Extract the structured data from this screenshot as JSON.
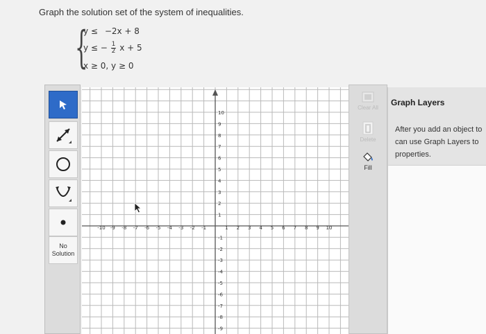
{
  "question": "Graph the solution set of the system of inequalities.",
  "system": {
    "line1": {
      "lhs": "y ≤",
      "rhs": "−2x + 8"
    },
    "line2": {
      "lhs": "y ≤ −",
      "num": "1",
      "den": "2",
      "rhs": "x + 5"
    },
    "line3": "x ≥ 0, y ≥ 0"
  },
  "toolbar": {
    "tools": [
      "pointer-tool",
      "segment-tool",
      "circle-tool",
      "parabola-tool",
      "point-tool"
    ],
    "no_solution_line1": "No",
    "no_solution_line2": "Solution"
  },
  "right_tools": {
    "clear_all": "Clear All",
    "delete": "Delete",
    "fill": "Fill"
  },
  "layers": {
    "title": "Graph Layers",
    "message_line1": "After you add an object to",
    "message_line2": "can use Graph Layers to",
    "message_line3": "properties."
  },
  "graph": {
    "x_ticks": [
      "-10",
      "-9",
      "-8",
      "-7",
      "-6",
      "-5",
      "-4",
      "-3",
      "-2",
      "-1",
      "1",
      "2",
      "3",
      "4",
      "5",
      "6",
      "7",
      "8",
      "9",
      "10"
    ],
    "y_ticks_pos": [
      "10",
      "9",
      "8",
      "7",
      "6",
      "5",
      "4",
      "3",
      "2",
      "1"
    ],
    "y_ticks_neg": [
      "-1",
      "-2",
      "-3",
      "-4",
      "-5",
      "-6",
      "-7",
      "-8",
      "-9"
    ]
  },
  "colors": {
    "active_tool": "#2e6bc8",
    "grid_line": "#b9b9b9",
    "axis": "#555555"
  }
}
